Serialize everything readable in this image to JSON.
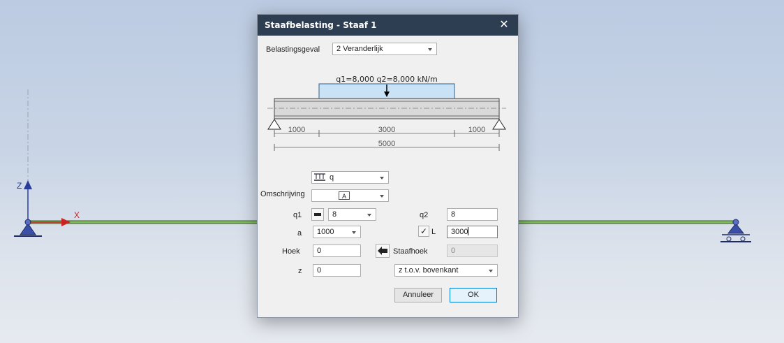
{
  "canvas": {
    "z_axis_label": "Z",
    "x_axis_label": "X"
  },
  "dialog": {
    "title": "Staafbelasting - Staaf 1",
    "close_glyph": "✕",
    "load_case_label": "Belastingsgeval",
    "load_case_value": "2 Veranderlijk",
    "diagram": {
      "load_label": "q1=8,000 q2=8,000 kN/m",
      "dim_left": "1000",
      "dim_mid": "3000",
      "dim_right": "1000",
      "dim_total": "5000"
    },
    "load_type_value": "q",
    "description_label": "Omschrijving",
    "q1_label": "q1",
    "q1_value": "8",
    "q2_label": "q2",
    "q2_value": "8",
    "a_label": "a",
    "a_value": "1000",
    "L_check": "✓",
    "L_label": "L",
    "L_value": "3000",
    "hoek_label": "Hoek",
    "hoek_value": "0",
    "staafhoek_label": "Staafhoek",
    "staafhoek_value": "0",
    "z_label": "z",
    "z_value": "0",
    "z_ref_value": "z t.o.v. bovenkant",
    "cancel_label": "Annuleer",
    "ok_label": "OK"
  },
  "colors": {
    "beam": "#7dbb5e",
    "axis_z": "#2a3d9a",
    "axis_x": "#cc2222",
    "load_fill": "#c9e2f5",
    "titlebar": "#2e3e52"
  },
  "icons": [
    "close-icon",
    "distributed-load-icon",
    "text-field-icon",
    "bar-load-icon",
    "checkbox-icon",
    "arrow-left-icon",
    "support-hinge-icon",
    "support-roller-icon"
  ]
}
